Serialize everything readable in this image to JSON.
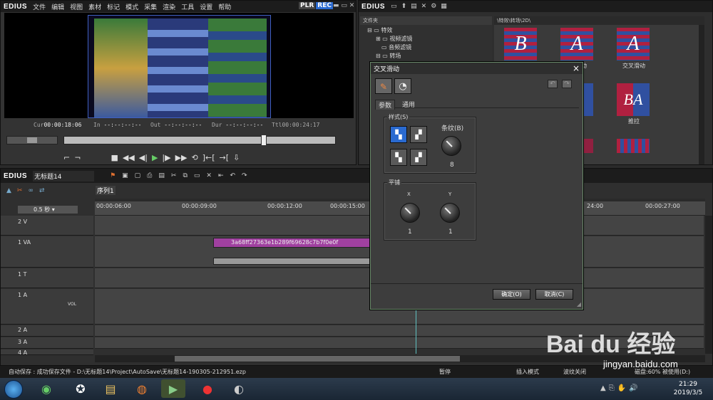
{
  "player": {
    "logo": "EDIUS",
    "menu": [
      "文件",
      "编辑",
      "视图",
      "素材",
      "标记",
      "模式",
      "采集",
      "渲染",
      "工具",
      "设置",
      "帮助"
    ],
    "plr": "PLR",
    "rec": "REC",
    "tc_cur_label": "Cur",
    "tc_cur": "00:00:18:06",
    "tc_in_label": "In",
    "tc_in": "--:--:--:--",
    "tc_out_label": "Out",
    "tc_out": "--:--:--:--",
    "tc_dur_label": "Dur",
    "tc_dur": "--:--:--:--",
    "tc_ttl_label": "Ttl",
    "tc_ttl": "00:00:24:17"
  },
  "library": {
    "logo": "EDIUS",
    "tree_header": "文件夹",
    "tree": [
      {
        "label": "特效"
      },
      {
        "label": "视频滤镜"
      },
      {
        "label": "音频滤镜"
      },
      {
        "label": "转场"
      }
    ],
    "path": "\\特效\\转场\\2D\\",
    "thumbs": [
      {
        "label": "",
        "letter": "B"
      },
      {
        "label": "动",
        "letter": "A"
      },
      {
        "label": "交叉滑动",
        "letter": "A"
      },
      {
        "label": "",
        "letter": ""
      },
      {
        "label": "",
        "letter": ""
      },
      {
        "label": "推拉",
        "letter": "BA"
      }
    ]
  },
  "timeline": {
    "logo": "EDIUS",
    "project": "无标题14",
    "sequence_tab": "序列1",
    "zoom": "0.5 秒",
    "ruler": [
      "00:00:06:00",
      "00:00:09:00",
      "00:00:12:00",
      "00:00:15:00",
      "24:00",
      "00:00:27:00"
    ],
    "tracks": [
      {
        "name": "2 V"
      },
      {
        "name": "1 VA"
      },
      {
        "name": "1 T"
      },
      {
        "name": "1 A",
        "vol": "VOL"
      },
      {
        "name": "2 A"
      },
      {
        "name": "3 A"
      },
      {
        "name": "4 A"
      }
    ],
    "clip_name": "3a68ff27363e1b289f69628c7b7f0e0f"
  },
  "dialog": {
    "title": "交叉滑动",
    "close": "×",
    "tabs": [
      "参数",
      "通用"
    ],
    "group_style": "样式(S)",
    "stripe_label": "条纹(B)",
    "stripe_value": "8",
    "group_tile": "平铺",
    "tile_x_label": "X",
    "tile_y_label": "Y",
    "tile_x_value": "1",
    "tile_y_value": "1",
    "ok": "确定(O)",
    "cancel": "取消(C)"
  },
  "status": {
    "left": "自动保存 : 成功保存文件 - D:\\无标题14\\Project\\AutoSave\\无标题14-190305-212951.ezp",
    "pause": "暂停",
    "insert": "插入模式",
    "ripple": "波纹关闭",
    "disk": "磁盘:60% 被使用(D:)"
  },
  "taskbar": {
    "time": "21:29",
    "date": "2019/3/5"
  },
  "watermark": {
    "brand": "Bai du 经验",
    "url": "jingyan.baidu.com"
  }
}
